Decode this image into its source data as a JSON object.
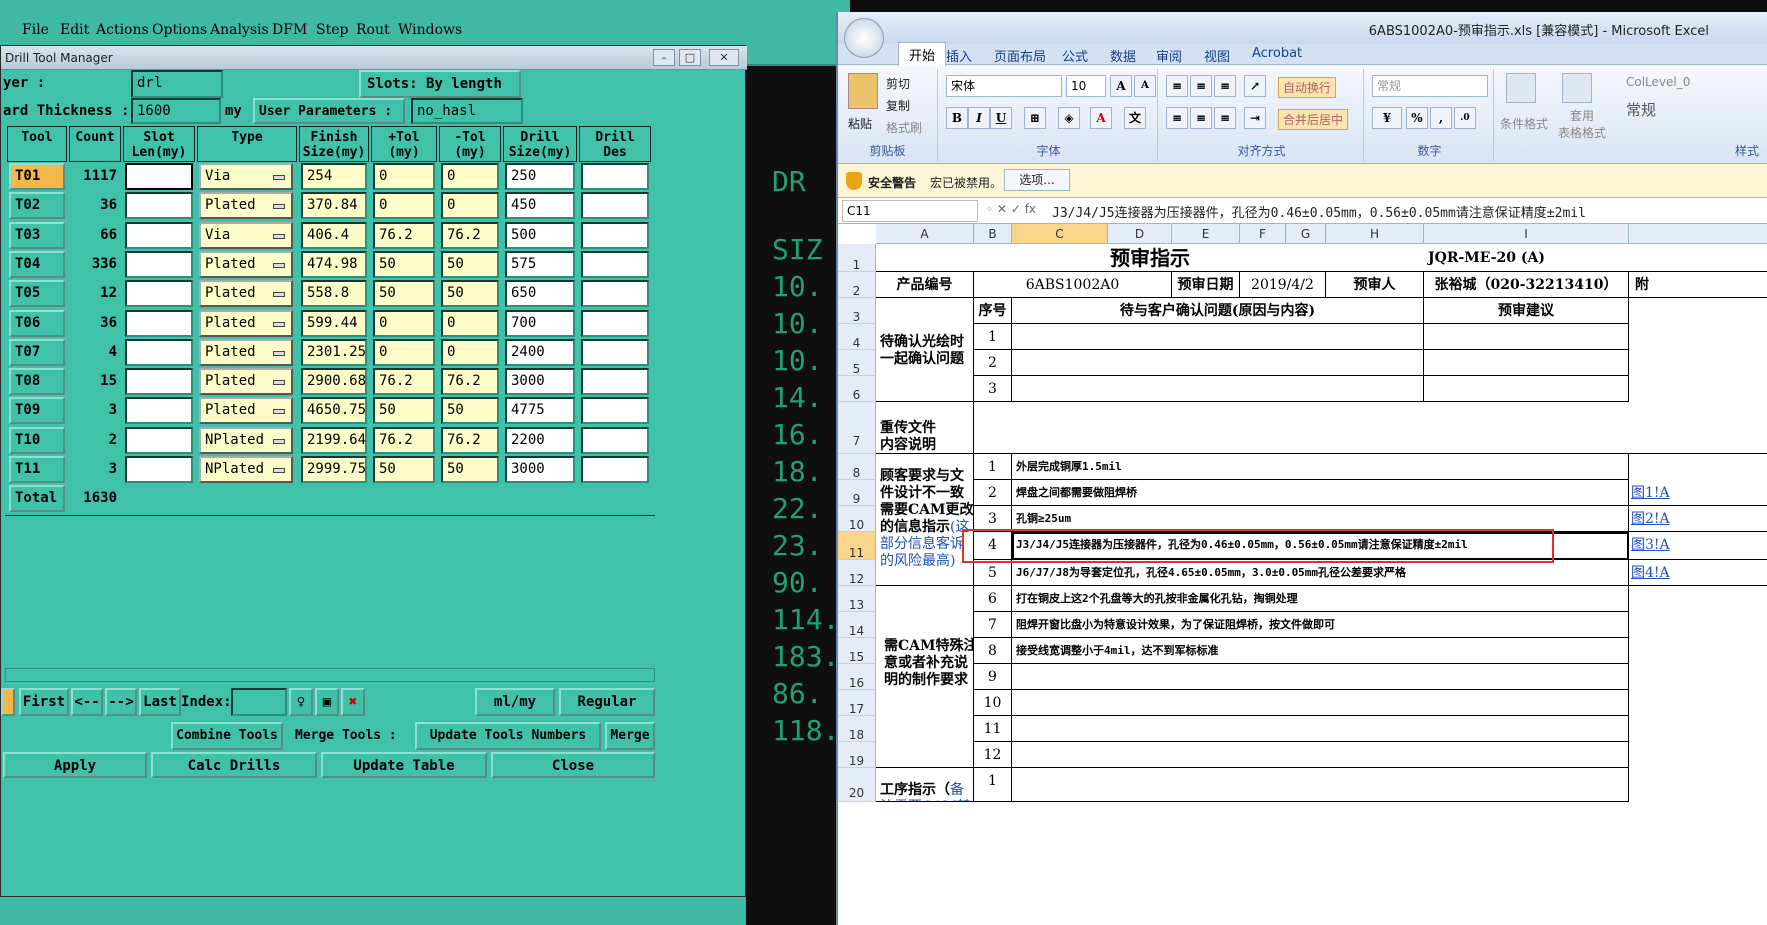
{
  "cam": {
    "menu": [
      "File",
      "Edit",
      "Actions",
      "Options",
      "Analysis",
      "DFM",
      "Step",
      "Rout",
      "Windows"
    ],
    "bg_readings": [
      "DR",
      "SIZ",
      "10.",
      "10.",
      "10.",
      "14.",
      "16.",
      "18.",
      "22.",
      "23.",
      "90.",
      "114.",
      "183.",
      "86.",
      "118."
    ]
  },
  "dialog": {
    "title": "Drill Tool Manager",
    "layer_label": "yer :",
    "layer_value": "drl",
    "slots_label": "Slots:",
    "slots_value": "By length",
    "board_label": "ard Thickness :",
    "board_value": "1600",
    "board_unit": "my",
    "user_params_label": "User Parameters :",
    "user_params_value": "no_hasl",
    "headers": [
      "Tool",
      "Count",
      "Slot\nLen(my)",
      "Type",
      "Finish\nSize(my)",
      "+Tol\n(my)",
      "-Tol\n(my)",
      "Drill\nSize(my)",
      "Drill\nDes"
    ],
    "rows": [
      {
        "tool": "T01",
        "count": "1117",
        "type": "Via",
        "finish": "254",
        "ptol": "0",
        "mtol": "0",
        "drill": "250"
      },
      {
        "tool": "T02",
        "count": "36",
        "type": "Plated",
        "finish": "370.84",
        "ptol": "0",
        "mtol": "0",
        "drill": "450"
      },
      {
        "tool": "T03",
        "count": "66",
        "type": "Via",
        "finish": "406.4",
        "ptol": "76.2",
        "mtol": "76.2",
        "drill": "500"
      },
      {
        "tool": "T04",
        "count": "336",
        "type": "Plated",
        "finish": "474.98",
        "ptol": "50",
        "mtol": "50",
        "drill": "575"
      },
      {
        "tool": "T05",
        "count": "12",
        "type": "Plated",
        "finish": "558.8",
        "ptol": "50",
        "mtol": "50",
        "drill": "650"
      },
      {
        "tool": "T06",
        "count": "36",
        "type": "Plated",
        "finish": "599.44",
        "ptol": "0",
        "mtol": "0",
        "drill": "700"
      },
      {
        "tool": "T07",
        "count": "4",
        "type": "Plated",
        "finish": "2301.25",
        "ptol": "0",
        "mtol": "0",
        "drill": "2400"
      },
      {
        "tool": "T08",
        "count": "15",
        "type": "Plated",
        "finish": "2900.68",
        "ptol": "76.2",
        "mtol": "76.2",
        "drill": "3000"
      },
      {
        "tool": "T09",
        "count": "3",
        "type": "Plated",
        "finish": "4650.75",
        "ptol": "50",
        "mtol": "50",
        "drill": "4775"
      },
      {
        "tool": "T10",
        "count": "2",
        "type": "NPlated",
        "finish": "2199.64",
        "ptol": "76.2",
        "mtol": "76.2",
        "drill": "2200"
      },
      {
        "tool": "T11",
        "count": "3",
        "type": "NPlated",
        "finish": "2999.75",
        "ptol": "50",
        "mtol": "50",
        "drill": "3000"
      }
    ],
    "total_label": "Total",
    "total_count": "1630",
    "nav": {
      "first": "First",
      "prev": "<--",
      "next": "-->",
      "last": "Last",
      "index_label": "Index:",
      "units": "ml/my",
      "mode": "Regular"
    },
    "buttons": {
      "combine": "Combine Tools",
      "merge_label": "Merge Tools :",
      "update_numbers": "Update Tools Numbers",
      "merge": "Merge",
      "apply": "Apply",
      "calc": "Calc Drills",
      "update_table": "Update Table",
      "close": "Close"
    }
  },
  "excel": {
    "title": "6ABS1002A0-预审指示.xls  [兼容模式] - Microsoft Excel",
    "tabs": [
      "开始",
      "插入",
      "页面布局",
      "公式",
      "数据",
      "审阅",
      "视图",
      "Acrobat"
    ],
    "clipboard": {
      "paste": "粘贴",
      "cut": "剪切",
      "copy": "复制",
      "format_painter": "格式刷",
      "group": "剪贴板"
    },
    "font": {
      "name": "宋体",
      "size": "10",
      "group": "字体"
    },
    "align": {
      "wrap": "自动换行",
      "merge": "合并后居中",
      "group": "对齐方式"
    },
    "number": {
      "format": "常规",
      "group": "数字"
    },
    "styles": {
      "cond": "条件格式",
      "table": "套用\n表格格式",
      "style_name": "ColLevel_0",
      "style_val": "常规",
      "group": "样式"
    },
    "security": {
      "label": "安全警告",
      "msg": "宏已被禁用。",
      "button": "选项..."
    },
    "namebox": "C11",
    "formula": "J3/J4/J5连接器为压接器件，孔径为0.46±0.05mm，0.56±0.05mm请注意保证精度±2mil",
    "cols": [
      "A",
      "B",
      "C",
      "D",
      "E",
      "F",
      "G",
      "H",
      "I"
    ],
    "sheet": {
      "title": "预审指示",
      "docno": "JQR-ME-20 (A)",
      "product_label": "产品编号",
      "product": "6ABS1002A0",
      "date_label": "预审日期",
      "date": "2019/4/2",
      "reviewer_label": "预审人",
      "reviewer": "张裕城（020-32213410）",
      "extra": "附",
      "seq_label": "序号",
      "issue_label": "待与客户确认问题(原因与内容)",
      "advice_label": "预审建议",
      "sec1": "待确认光绘时\n一起确认问题",
      "sec2": "重传文件\n内容说明",
      "sec3a": "顾客要求与文\n件设计不一致\n需要CAM更改\n的信息指示",
      "sec3b": "(这\n部分信息客诉\n的风险最高)",
      "sec4": "需CAM特殊注\n意或者补充说\n明的制作要求",
      "sec5a": "工序指示（",
      "sec5b": "备\n注需要CAM转化",
      "items": [
        "外层完成铜厚1.5mil",
        "焊盘之间都需要做阻焊桥",
        "孔铜≥25um",
        "J3/J4/J5连接器为压接器件，孔径为0.46±0.05mm，0.56±0.05mm请注意保证精度±2mil",
        "J6/J7/J8为导套定位孔，孔径4.65±0.05mm，3.0±0.05mm孔径公差要求严格",
        "打在铜皮上这2个孔盘等大的孔按非金属化孔钻，掏铜处理",
        "阻焊开窗比盘小为特意设计效果，为了保证阻焊桥，按文件做即可",
        "接受线宽调整小于4mil，达不到军标标准"
      ],
      "links": [
        "图1!A",
        "图2!A",
        "图3!A",
        "图4!A"
      ]
    }
  }
}
